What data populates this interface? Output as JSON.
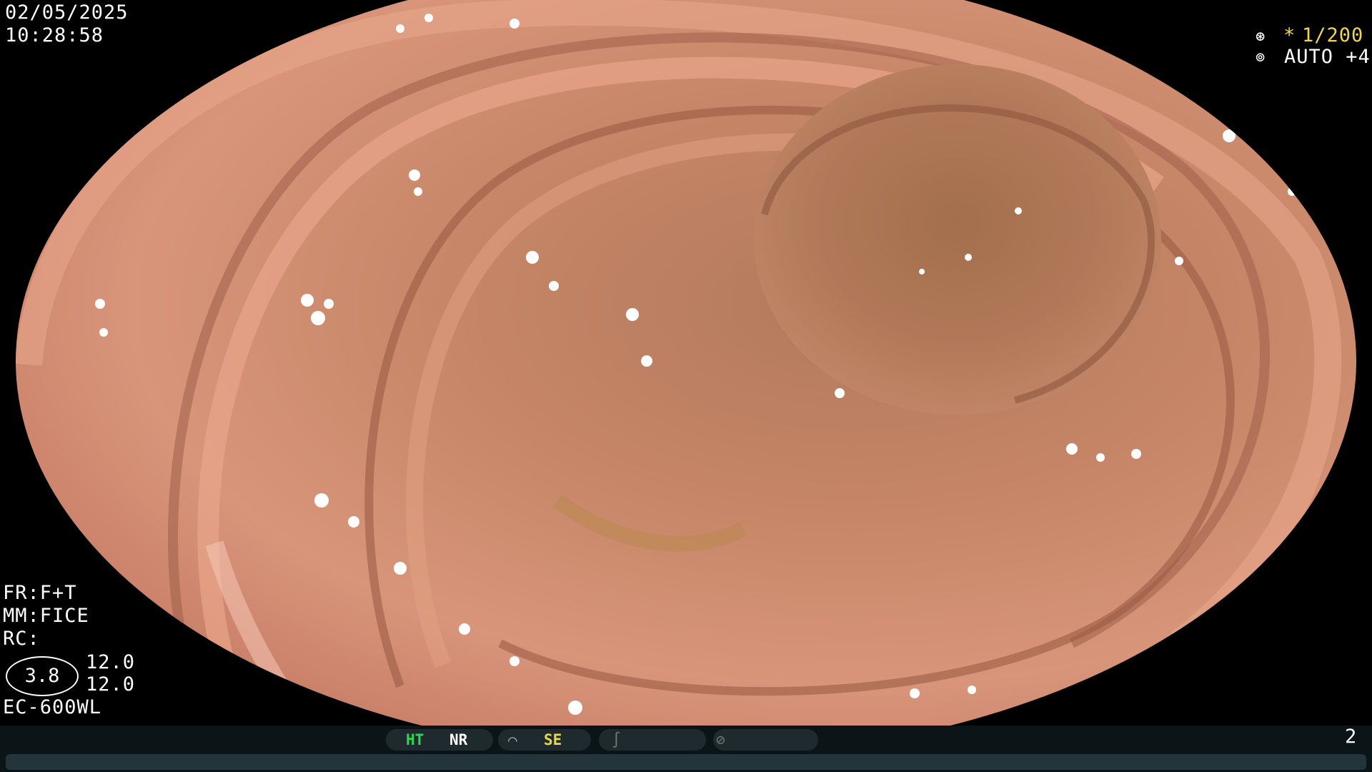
{
  "overlay": {
    "date": "02/05/2025",
    "time": "10:28:58",
    "shutter": "1/200",
    "shutter_mark": "*",
    "iris": "AUTO +4",
    "fr": "FR:F+T",
    "mm": "MM:FICE",
    "rc": "RC:",
    "ring_value": "3.8",
    "value_1": "12.0",
    "value_2": "12.0",
    "model": "EC-600WL",
    "page_number": "2"
  },
  "status_bar": {
    "ht": "HT",
    "nr": "NR",
    "se": "SE"
  },
  "colors": {
    "ht": "#35d455",
    "se": "#e8d84a",
    "shutter": "#f0d64a"
  }
}
